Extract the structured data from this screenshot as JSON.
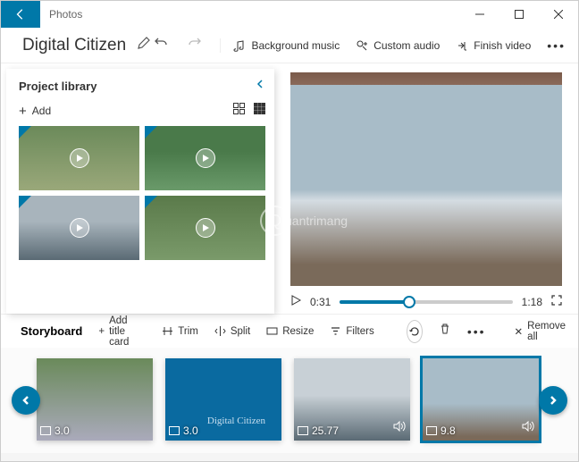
{
  "app": {
    "name": "Photos"
  },
  "project": {
    "title": "Digital Citizen"
  },
  "toolbar": {
    "background_music": "Background music",
    "custom_audio": "Custom audio",
    "finish_video": "Finish video"
  },
  "library": {
    "title": "Project library",
    "add_label": "Add"
  },
  "player": {
    "current_time": "0:31",
    "total_time": "1:18"
  },
  "watermark": {
    "text": "uantrimang"
  },
  "storyboard": {
    "title": "Storyboard",
    "add_title_card": "Add title card",
    "trim": "Trim",
    "split": "Split",
    "resize": "Resize",
    "filters": "Filters",
    "remove_all": "Remove all",
    "clips": [
      {
        "duration": "3.0"
      },
      {
        "duration": "3.0",
        "caption": "Digital Citizen"
      },
      {
        "duration": "25.77"
      },
      {
        "duration": "9.8"
      }
    ]
  }
}
